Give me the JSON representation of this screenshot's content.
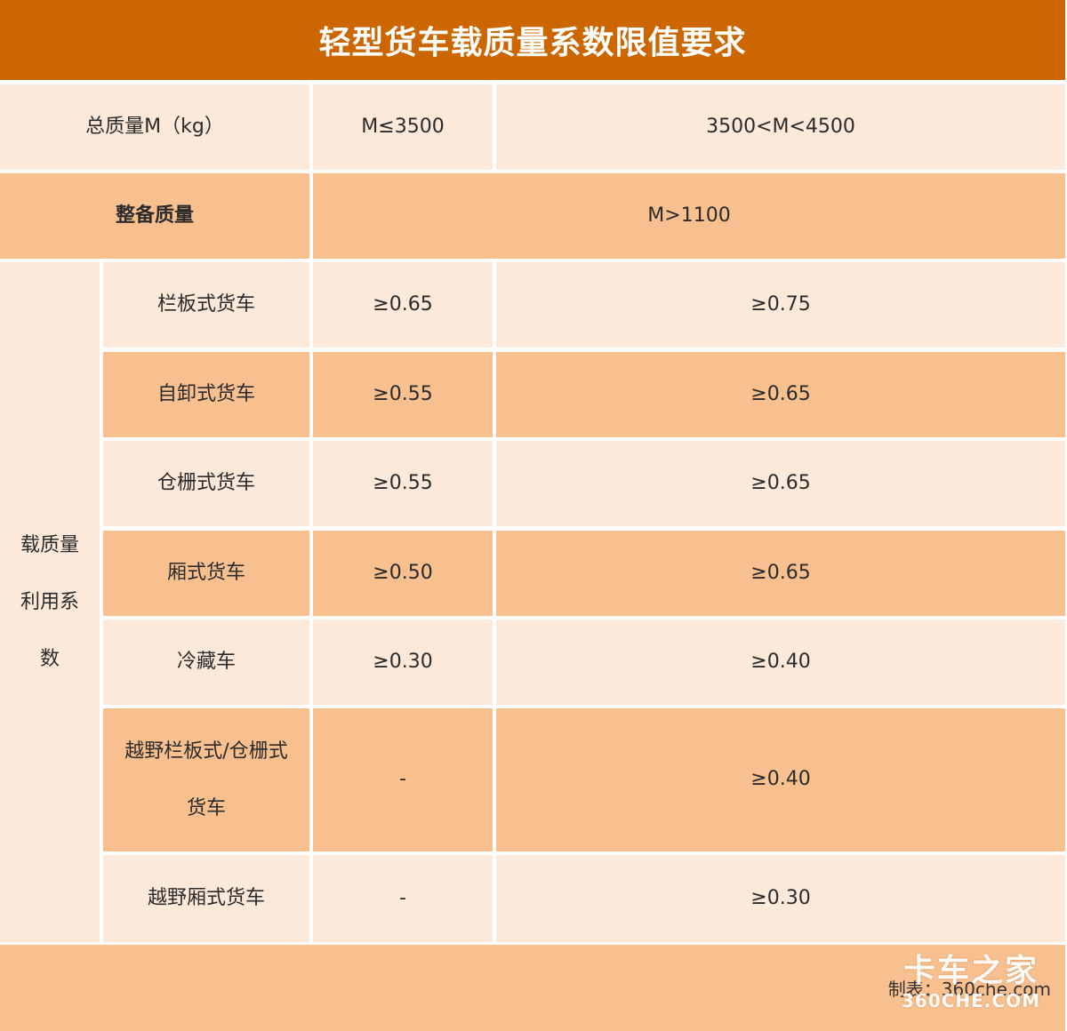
{
  "title": "轻型货车载质量系数限值要求",
  "header_row": {
    "label": "总质量M（kg）",
    "col1": "M≤3500",
    "col2": "3500<M<4500"
  },
  "curb_row": {
    "label": "整备质量",
    "value": "M>1100"
  },
  "group_label": [
    "载质量",
    "利用系",
    "数"
  ],
  "rows": [
    {
      "type": "栏板式货车",
      "v1": "≥0.65",
      "v2": "≥0.75"
    },
    {
      "type": "自卸式货车",
      "v1": "≥0.55",
      "v2": "≥0.65"
    },
    {
      "type": "仓栅式货车",
      "v1": "≥0.55",
      "v2": "≥0.65"
    },
    {
      "type": "厢式货车",
      "v1": "≥0.50",
      "v2": "≥0.65"
    },
    {
      "type": "冷藏车",
      "v1": "≥0.30",
      "v2": "≥0.40"
    },
    {
      "type_lines": [
        "越野栏板式/仓栅式",
        "货车"
      ],
      "v1": "-",
      "v2": "≥0.40"
    },
    {
      "type": "越野厢式货车",
      "v1": "-",
      "v2": "≥0.30"
    }
  ],
  "footer": {
    "credit": "制表：360che.com"
  },
  "watermark": {
    "cn": "卡车之家",
    "en": "360CHE.COM"
  },
  "colors": {
    "title_bg": "#cc6600",
    "light_cell": "#fce9d9",
    "dark_cell": "#f9c08f"
  }
}
